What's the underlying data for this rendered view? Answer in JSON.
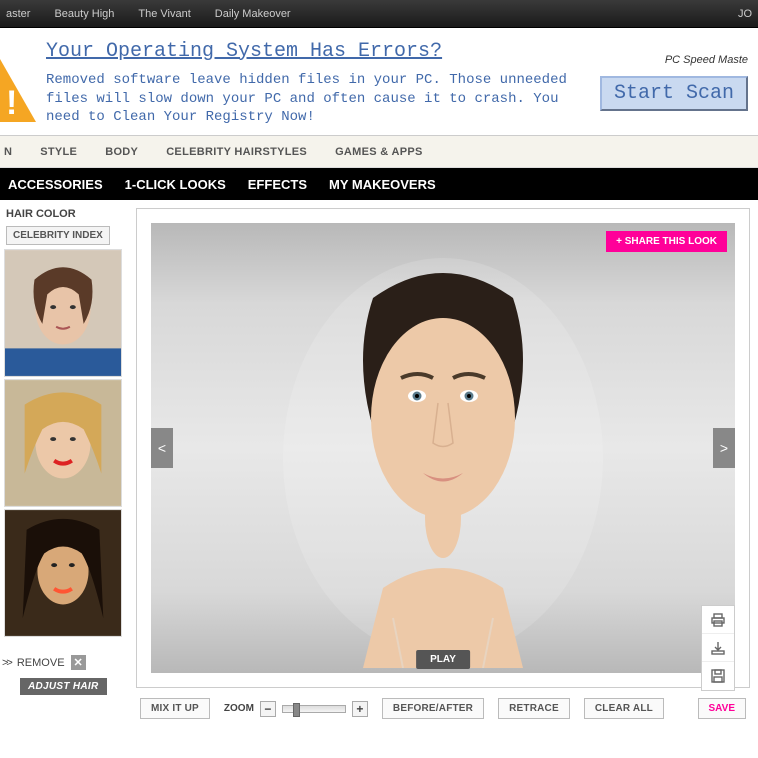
{
  "top_nav": {
    "items": [
      "aster",
      "Beauty High",
      "The Vivant",
      "Daily Makeover"
    ],
    "right": "JO"
  },
  "ad": {
    "headline": "Your Operating System Has Errors?",
    "body": "Removed software leave hidden files in your PC. Those unneeded files will slow down your PC and often cause it to crash. You need to Clean Your Registry Now!",
    "brand": "PC Speed Maste",
    "button": "Start Scan"
  },
  "cat_nav": [
    "N",
    "STYLE",
    "BODY",
    "CELEBRITY HAIRSTYLES",
    "GAMES & APPS"
  ],
  "sub_nav": [
    "ACCESSORIES",
    "1-CLICK LOOKS",
    "EFFECTS",
    "MY MAKEOVERS"
  ],
  "sidebar": {
    "title": "HAIR COLOR",
    "celeb_index": "CELEBRITY INDEX",
    "remove_arrows": ">>",
    "remove_label": "REMOVE",
    "adjust_hair": "ADJUST HAIR"
  },
  "canvas": {
    "share": "+ SHARE THIS LOOK",
    "play": "PLAY",
    "prev": "<",
    "next": ">"
  },
  "bottom": {
    "mix": "MIX IT UP",
    "zoom_label": "ZOOM",
    "minus": "−",
    "plus": "+",
    "before_after": "BEFORE/AFTER",
    "retrace": "RETRACE",
    "clear_all": "CLEAR ALL",
    "save": "SAVE"
  }
}
